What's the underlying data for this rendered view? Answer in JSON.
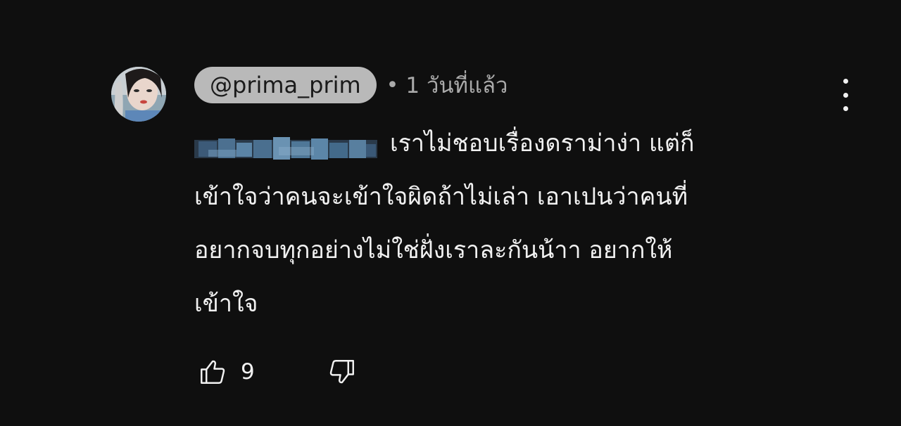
{
  "comment": {
    "handle": "@prima_prim",
    "separator": "•",
    "timestamp": "1 วันที่แล้ว",
    "lines": [
      "เราไม่ชอบเรื่องดราม่าง่า แต่ก็",
      "เข้าใจว่าคนจะเข้าใจผิดถ้าไม่เล่า เอาเปนว่าคนที่",
      "อยากจบทุกอย่างไม่ใช่ฝั่งเราละกันน้าา อยากให้",
      "เข้าใจ"
    ],
    "like_count": "9"
  },
  "icons": {
    "avatar": "avatar",
    "more": "more-vert-icon",
    "like": "thumb-up-icon",
    "dislike": "thumb-down-icon"
  },
  "colors": {
    "background": "#0f0f0f",
    "text": "#f1f1f1",
    "secondary_text": "#aaaaaa",
    "handle_pill": "#b9b9b9"
  }
}
